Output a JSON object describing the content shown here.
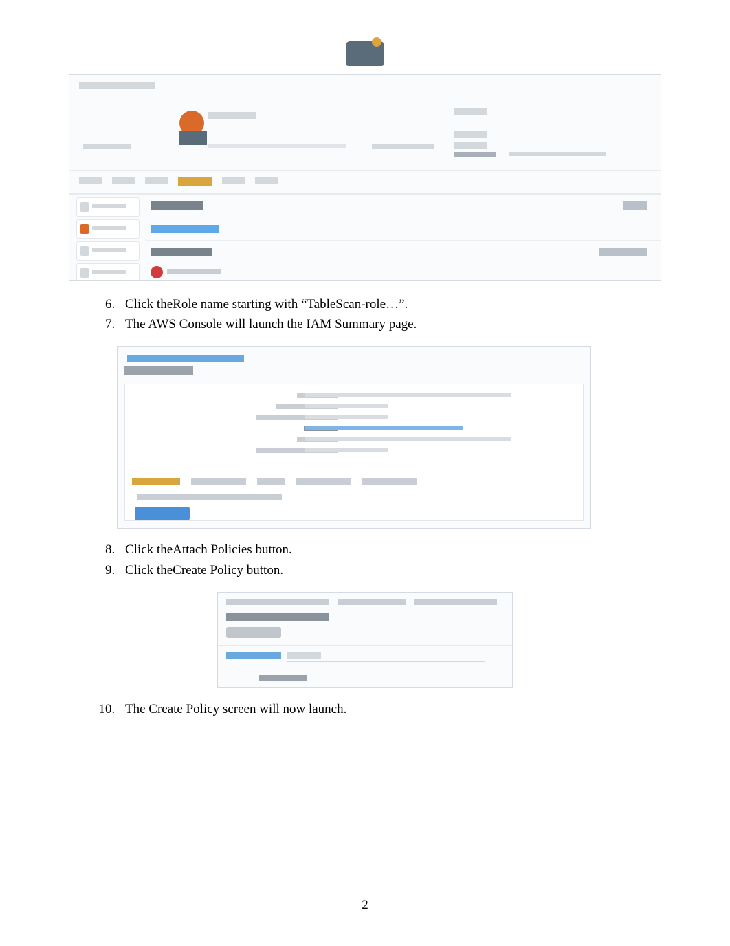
{
  "page_number": "2",
  "steps": [
    {
      "num": 6,
      "prefix": "Click the",
      "strong": "Role name",
      "suffix": " starting with “TableScan-role…”."
    },
    {
      "num": 7,
      "text": "The AWS Console will launch the IAM Summary page."
    },
    {
      "num": 8,
      "prefix": "Click the",
      "strong": "Attach Policies",
      "suffix": "button."
    },
    {
      "num": 9,
      "prefix": "Click the",
      "strong": "Create Policy",
      "suffix": "button."
    },
    {
      "num": 10,
      "text": "The Create Policy screen will now launch."
    }
  ]
}
